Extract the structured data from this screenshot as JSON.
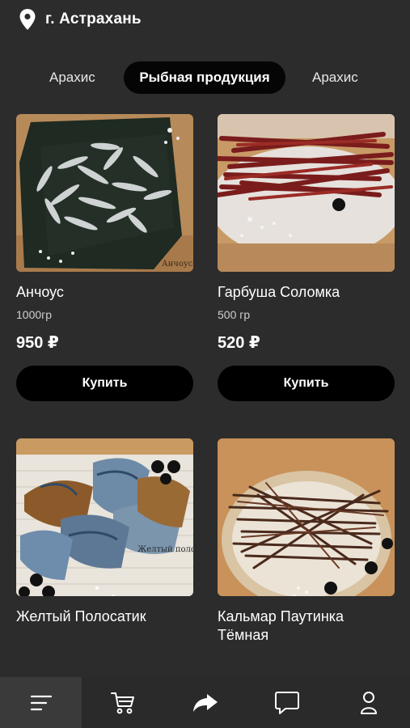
{
  "location": {
    "city": "г. Астрахань",
    "icon": "location-pin-icon"
  },
  "categories": [
    {
      "label": "Арахис",
      "active": false
    },
    {
      "label": "Рыбная продукция",
      "active": true
    },
    {
      "label": "Арахис",
      "active": false
    }
  ],
  "products": [
    {
      "name": "Анчоус",
      "weight": "1000гр",
      "price": "950 ₽",
      "buy_label": "Купить",
      "photo_watermark": "Анчоус"
    },
    {
      "name": "Гарбуша Соломка",
      "weight": "500 гр",
      "price": "520 ₽",
      "buy_label": "Купить"
    },
    {
      "name": "Желтый Полосатик",
      "photo_watermark": "Желтый поло"
    },
    {
      "name": "Кальмар Паутинка Тёмная"
    }
  ],
  "nav": {
    "items": [
      "menu-icon",
      "cart-icon",
      "share-icon",
      "chat-icon",
      "profile-icon"
    ],
    "active_index": 0
  },
  "colors": {
    "background": "#2c2c2c",
    "button": "#000000",
    "text": "#ffffff"
  }
}
